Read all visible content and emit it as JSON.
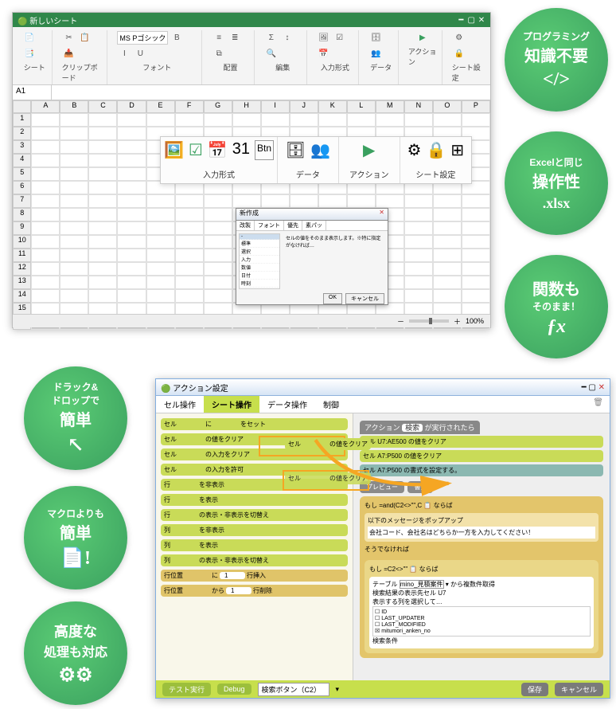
{
  "badges_right": [
    {
      "l1": "プログラミング",
      "l2": "知識不要",
      "glyph": "</>"
    },
    {
      "l1": "Excelと同じ",
      "l2": "操作性",
      "glyph": ".xlsx"
    },
    {
      "l1": "関数も",
      "l2": "そのまま！",
      "glyph": "ƒx"
    }
  ],
  "badges_left": [
    {
      "l1a": "ドラック&",
      "l1b": "ドロップで",
      "l2": "簡単",
      "glyph": "↖"
    },
    {
      "l1": "マクロよりも",
      "l2": "簡単",
      "glyph": "📄!"
    },
    {
      "l1a": "高度な",
      "l1b": "処理も対応",
      "l2": "",
      "glyph": "⚙⚙"
    }
  ],
  "excel": {
    "title": "新しいシート",
    "font": "MS Pゴシック",
    "ribbon_groups": [
      "シート",
      "クリップボード",
      "フォント",
      "配置",
      "編集",
      "入力形式",
      "データ",
      "アクション",
      "シート設定"
    ],
    "namebox": "A1",
    "cols": [
      "A",
      "B",
      "C",
      "D",
      "E",
      "F",
      "G",
      "H",
      "I",
      "J",
      "K",
      "L",
      "M",
      "N",
      "O",
      "P"
    ],
    "zoom": "100%",
    "popout": {
      "groups": [
        {
          "label": "入力形式",
          "icons": [
            "🖼",
            "☑",
            "📅",
            "31",
            "Btn"
          ]
        },
        {
          "label": "データ",
          "icons": [
            "🗄",
            "👥"
          ]
        },
        {
          "label": "アクション",
          "icons": [
            "▶"
          ]
        },
        {
          "label": "シート設定",
          "icons": [
            "⚙",
            "🔒",
            "⊞"
          ]
        }
      ]
    },
    "dialog": {
      "title": "新作成",
      "tabs": [
        "改製",
        "フォント",
        "優先",
        "素パッ"
      ],
      "list": [
        "-",
        "標準",
        "選択",
        "入力",
        "数値",
        "日付",
        "時刻"
      ],
      "msg": "セルの値をそのまま表示します。※特に指定がなければ…",
      "ok": "OK",
      "cancel": "キャンセル"
    }
  },
  "action": {
    "title": "アクション設定",
    "tabs": [
      "セル操作",
      "シート操作",
      "データ操作",
      "制御"
    ],
    "active_tab": 1,
    "palette": [
      {
        "t": "セル",
        "a": "",
        "b": "に",
        "c": "",
        "d": "をセット"
      },
      {
        "t": "セル",
        "a": "",
        "b": "の値をクリア"
      },
      {
        "t": "セル",
        "a": "",
        "b": "の入力をクリア"
      },
      {
        "t": "セル",
        "a": "",
        "b": "の入力を許可"
      },
      {
        "t": "行",
        "a": "",
        "b": "を非表示"
      },
      {
        "t": "行",
        "a": "",
        "b": "を表示"
      },
      {
        "t": "行",
        "a": "",
        "b": "の表示・非表示を切替え"
      },
      {
        "t": "列",
        "a": "",
        "b": "を非表示"
      },
      {
        "t": "列",
        "a": "",
        "b": "を表示"
      },
      {
        "t": "列",
        "a": "",
        "b": "の表示・非表示を切替え"
      },
      {
        "t": "行位置",
        "a": "",
        "b": "に",
        "c": "1",
        "d": "行挿入",
        "cls": "manila"
      },
      {
        "t": "行位置",
        "a": "",
        "b": "から",
        "c": "1",
        "d": "行削除",
        "cls": "manila"
      }
    ],
    "drag_block": {
      "t": "セル",
      "a": "",
      "b": "の値をクリア"
    },
    "canvas": {
      "header": {
        "label": "アクション",
        "pill": "検索",
        "suffix": "が実行されたら"
      },
      "lines": [
        "セル  U7:AE500  の値をクリア",
        "セル  A7:P500  の値をクリア",
        "セル  A7:P500  の書式を設定する。"
      ],
      "btn_preview": "プレビュー",
      "btn_format": "書式",
      "if_cond": "=and(C2<>\"\",C",
      "if_label": "もし",
      "then_label": "ならば",
      "popup_label": "以下のメッセージをポップアップ",
      "popup_msg": "会社コード、会社名はどちらか一方を入力してください！",
      "else_label": "そうでなければ",
      "if2_cond": "=C2<>\"\"",
      "table_label": "テーブル",
      "table_value": "mino_見積案件",
      "table_suffix": "から複数件取得",
      "seltgt_label": "検索結果の表示先セル",
      "seltgt_value": "U7",
      "cols_label": "表示する列を選択して…",
      "cols": [
        "ID",
        "LAST_UPDATER",
        "LAST_MODIFIED",
        "mitumori_anken_no"
      ],
      "cols_checked": [
        false,
        false,
        false,
        true
      ],
      "cond_label": "検索条件"
    },
    "footer": {
      "test": "テスト実行",
      "debug": "Debug",
      "select_value": "検索ボタン（C2）",
      "save": "保存",
      "cancel": "キャンセル"
    }
  }
}
